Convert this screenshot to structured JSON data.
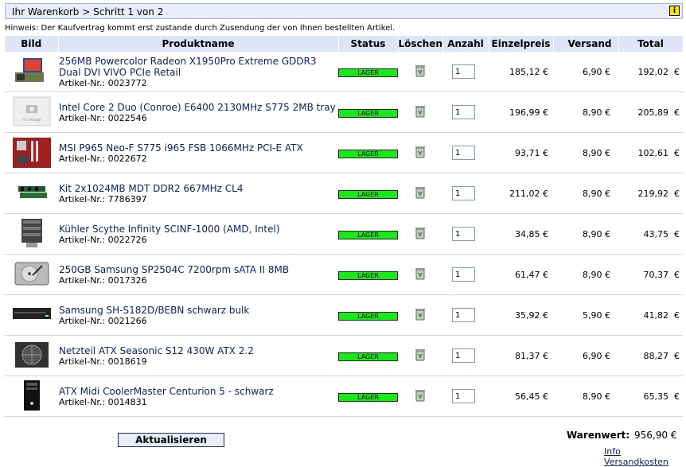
{
  "header": {
    "title": "Ihr Warenkorb > Schritt 1 von 2",
    "info_label": "i"
  },
  "hint": "Hinweis: Der Kaufvertrag kommt erst zustande durch Zusendung der von Ihnen bestellten Artikel.",
  "columns": [
    "Bild",
    "Produktname",
    "Status",
    "Löschen",
    "Anzahl",
    "Einzelpreis",
    "Versand",
    "Total"
  ],
  "items": [
    {
      "name": "256MB Powercolor Radeon X1950Pro Extreme GDDR3 Dual DVI VIVO PCIe Retail",
      "art": "Artikel-Nr.: 0023772",
      "status": "LAGER",
      "qty": "1",
      "price": "185,12 €",
      "ship": "6,90 €",
      "total": "192,02",
      "icon": "graphics-card-icon"
    },
    {
      "name": "Intel Core 2 Duo (Conroe) E6400 2130MHz S775 2MB tray",
      "art": "Artikel-Nr.: 0022546",
      "status": "LAGER",
      "qty": "1",
      "price": "196,99 €",
      "ship": "8,90 €",
      "total": "205,89",
      "icon": "no-image-icon"
    },
    {
      "name": "MSI P965 Neo-F S775 i965 FSB 1066MHz PCI-E ATX",
      "art": "Artikel-Nr.: 0022672",
      "status": "LAGER",
      "qty": "1",
      "price": "93,71 €",
      "ship": "8,90 €",
      "total": "102,61",
      "icon": "motherboard-icon"
    },
    {
      "name": "Kit 2x1024MB MDT DDR2 667MHz CL4",
      "art": "Artikel-Nr.: 7786397",
      "status": "LAGER",
      "qty": "1",
      "price": "211,02 €",
      "ship": "8,90 €",
      "total": "219,92",
      "icon": "ram-icon"
    },
    {
      "name": "Kühler Scythe Infinity SCINF-1000 (AMD, Intel)",
      "art": "Artikel-Nr.: 0022726",
      "status": "LAGER",
      "qty": "1",
      "price": "34,85 €",
      "ship": "8,90 €",
      "total": "43,75",
      "icon": "cpu-cooler-icon"
    },
    {
      "name": "250GB Samsung SP2504C 7200rpm sATA II 8MB",
      "art": "Artikel-Nr.: 0017326",
      "status": "LAGER",
      "qty": "1",
      "price": "61,47 €",
      "ship": "8,90 €",
      "total": "70,37",
      "icon": "hard-drive-icon"
    },
    {
      "name": "Samsung SH-S182D/BEBN schwarz bulk",
      "art": "Artikel-Nr.: 0021266",
      "status": "LAGER",
      "qty": "1",
      "price": "35,92 €",
      "ship": "5,90 €",
      "total": "41,82",
      "icon": "optical-drive-icon"
    },
    {
      "name": "Netzteil ATX Seasonic S12 430W ATX 2.2",
      "art": "Artikel-Nr.: 0018619",
      "status": "LAGER",
      "qty": "1",
      "price": "81,37 €",
      "ship": "6,90 €",
      "total": "88,27",
      "icon": "power-supply-icon"
    },
    {
      "name": "ATX Midi CoolerMaster Centurion 5 - schwarz",
      "art": "Artikel-Nr.: 0014831",
      "status": "LAGER",
      "qty": "1",
      "price": "56,45 €",
      "ship": "8,90 €",
      "total": "65,35",
      "icon": "pc-case-icon"
    }
  ],
  "currency": "€",
  "footer": {
    "update_label": "Aktualisieren",
    "warenwert_label": "Warenwert:",
    "warenwert_value": "956,90 €",
    "versand_link": "Info Versandkosten"
  },
  "colors": {
    "header_bg": "#dfe5f7",
    "status_green": "#19e819",
    "link_blue": "#0a246a"
  }
}
